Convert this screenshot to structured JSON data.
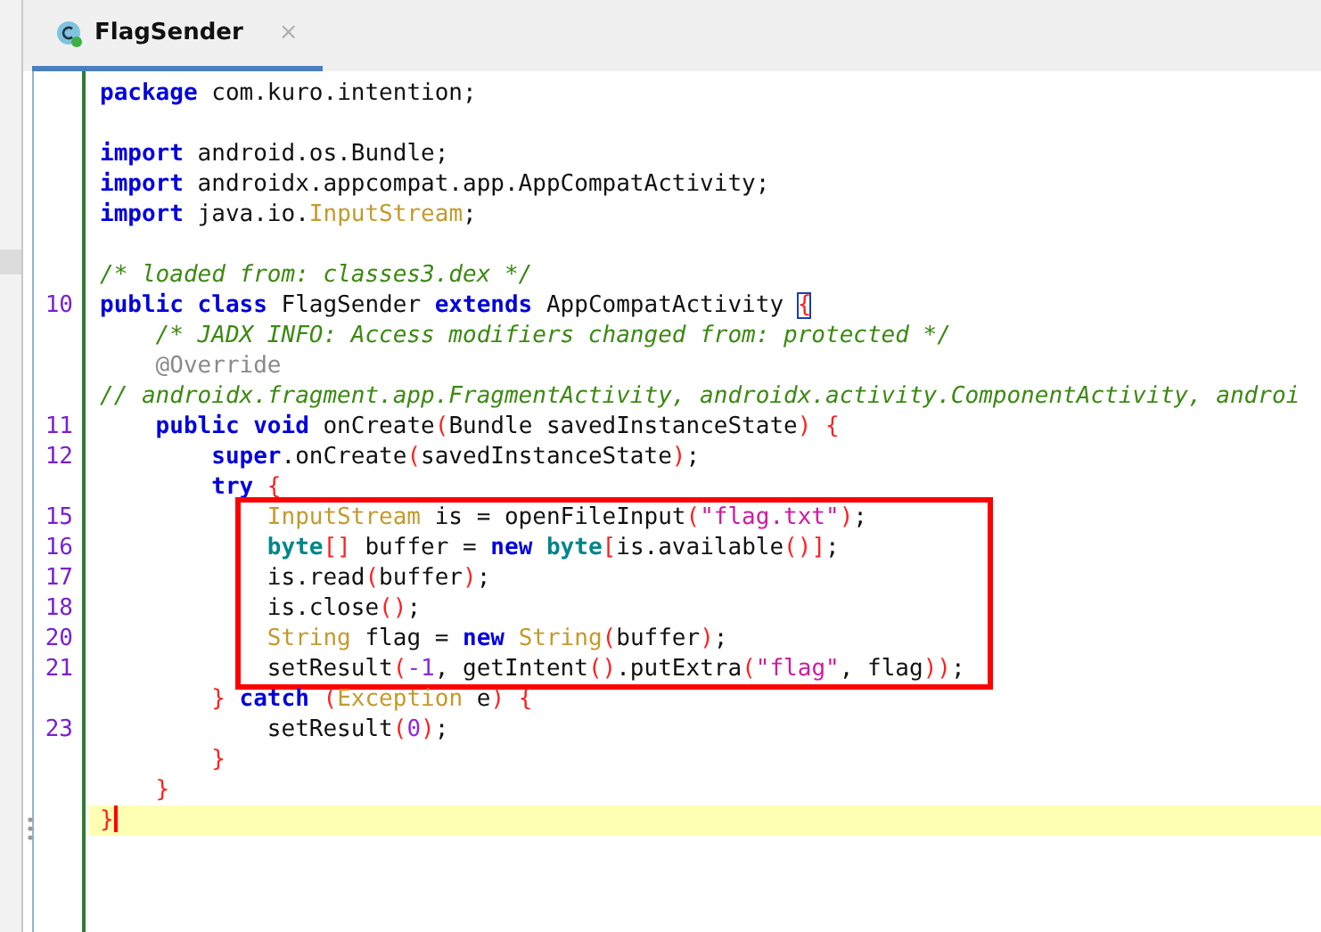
{
  "tab": {
    "title": "FlagSender",
    "close": "×",
    "selected": true
  },
  "blocks": [
    {
      "boxed": false,
      "lines": [
        {
          "current": false,
          "tokens": [
            {
              "kind": "keyword",
              "text": "package"
            },
            {
              "kind": "plain",
              "text": " com.kuro.intention;"
            }
          ]
        },
        {
          "current": false
        },
        {
          "current": false,
          "tokens": [
            {
              "kind": "keyword",
              "text": "import"
            },
            {
              "kind": "plain",
              "text": " android.os.Bundle;"
            }
          ]
        },
        {
          "current": false,
          "tokens": [
            {
              "kind": "keyword",
              "text": "import"
            },
            {
              "kind": "plain",
              "text": " androidx.appcompat.app.AppCompatActivity;"
            }
          ]
        },
        {
          "current": false,
          "tokens": [
            {
              "kind": "keyword",
              "text": "import"
            },
            {
              "kind": "plain",
              "text": " java.io."
            },
            {
              "kind": "type",
              "text": "InputStream"
            },
            {
              "kind": "plain",
              "text": ";"
            }
          ]
        },
        {
          "current": false
        },
        {
          "current": false,
          "tokens": [
            {
              "kind": "comment",
              "text": "/* loaded from: classes3.dex */"
            }
          ]
        },
        {
          "number": "10",
          "current": false,
          "tokens": [
            {
              "kind": "keyword",
              "text": "public class"
            },
            {
              "kind": "plain",
              "text": " FlagSender "
            },
            {
              "kind": "keyword",
              "text": "extends"
            },
            {
              "kind": "plain",
              "text": " AppCompatActivity "
            },
            {
              "kind": "matched",
              "text": "{"
            }
          ]
        },
        {
          "current": false,
          "tokens": [
            {
              "kind": "comment",
              "text": "    /* JADX INFO: Access modifiers changed from: protected */"
            }
          ]
        },
        {
          "current": false,
          "tokens": [
            {
              "kind": "annotation",
              "text": "    @Override"
            }
          ]
        },
        {
          "current": false,
          "tokens": [
            {
              "kind": "comment",
              "text": "// androidx.fragment.app.FragmentActivity, androidx.activity.ComponentActivity, androi"
            }
          ]
        },
        {
          "number": "11",
          "current": false,
          "tokens": [
            {
              "kind": "keyword",
              "text": "    public void"
            },
            {
              "kind": "plain",
              "text": " onCreate"
            },
            {
              "kind": "bracket",
              "text": "("
            },
            {
              "kind": "plain",
              "text": "Bundle savedInstanceState"
            },
            {
              "kind": "bracket",
              "text": ") {"
            }
          ]
        },
        {
          "number": "12",
          "current": false,
          "tokens": [
            {
              "kind": "keyword",
              "text": "        super"
            },
            {
              "kind": "plain",
              "text": ".onCreate"
            },
            {
              "kind": "bracket",
              "text": "("
            },
            {
              "kind": "plain",
              "text": "savedInstanceState"
            },
            {
              "kind": "bracket",
              "text": ")"
            },
            {
              "kind": "plain",
              "text": ";"
            }
          ]
        },
        {
          "current": false,
          "tokens": [
            {
              "kind": "keyword",
              "text": "        try"
            },
            {
              "kind": "bracket",
              "text": " {"
            }
          ]
        }
      ]
    },
    {
      "boxed": true,
      "lines": [
        {
          "number": "15",
          "current": false,
          "tokens": [
            {
              "kind": "type",
              "text": "            InputStream"
            },
            {
              "kind": "plain",
              "text": " is = openFileInput"
            },
            {
              "kind": "bracket",
              "text": "("
            },
            {
              "kind": "string",
              "text": "\"flag.txt\""
            },
            {
              "kind": "bracket",
              "text": ")"
            },
            {
              "kind": "plain",
              "text": ";"
            }
          ]
        },
        {
          "number": "16",
          "current": false,
          "tokens": [
            {
              "kind": "primitive",
              "text": "            byte"
            },
            {
              "kind": "bracket",
              "text": "[]"
            },
            {
              "kind": "plain",
              "text": " buffer = "
            },
            {
              "kind": "keyword",
              "text": "new"
            },
            {
              "kind": "primitive",
              "text": " byte"
            },
            {
              "kind": "bracket",
              "text": "["
            },
            {
              "kind": "plain",
              "text": "is.available"
            },
            {
              "kind": "bracket",
              "text": "()]"
            },
            {
              "kind": "plain",
              "text": ";"
            }
          ]
        },
        {
          "number": "17",
          "current": false,
          "tokens": [
            {
              "kind": "plain",
              "text": "            is.read"
            },
            {
              "kind": "bracket",
              "text": "("
            },
            {
              "kind": "plain",
              "text": "buffer"
            },
            {
              "kind": "bracket",
              "text": ")"
            },
            {
              "kind": "plain",
              "text": ";"
            }
          ]
        },
        {
          "number": "18",
          "current": false,
          "tokens": [
            {
              "kind": "plain",
              "text": "            is.close"
            },
            {
              "kind": "bracket",
              "text": "()"
            },
            {
              "kind": "plain",
              "text": ";"
            }
          ]
        },
        {
          "number": "20",
          "current": false,
          "tokens": [
            {
              "kind": "type",
              "text": "            String"
            },
            {
              "kind": "plain",
              "text": " flag = "
            },
            {
              "kind": "keyword",
              "text": "new"
            },
            {
              "kind": "type",
              "text": " String"
            },
            {
              "kind": "bracket",
              "text": "("
            },
            {
              "kind": "plain",
              "text": "buffer"
            },
            {
              "kind": "bracket",
              "text": ")"
            },
            {
              "kind": "plain",
              "text": ";"
            }
          ]
        },
        {
          "number": "21",
          "current": false,
          "tokens": [
            {
              "kind": "plain",
              "text": "            setResult"
            },
            {
              "kind": "bracket",
              "text": "("
            },
            {
              "kind": "number",
              "text": "-1"
            },
            {
              "kind": "plain",
              "text": ", getIntent"
            },
            {
              "kind": "bracket",
              "text": "()"
            },
            {
              "kind": "plain",
              "text": ".putExtra"
            },
            {
              "kind": "bracket",
              "text": "("
            },
            {
              "kind": "string",
              "text": "\"flag\""
            },
            {
              "kind": "plain",
              "text": ", flag"
            },
            {
              "kind": "bracket",
              "text": "))"
            },
            {
              "kind": "plain",
              "text": ";"
            }
          ]
        }
      ]
    },
    {
      "boxed": false,
      "lines": [
        {
          "current": false,
          "tokens": [
            {
              "kind": "bracket",
              "text": "        }"
            },
            {
              "kind": "keyword",
              "text": " catch"
            },
            {
              "kind": "bracket",
              "text": " ("
            },
            {
              "kind": "type",
              "text": "Exception"
            },
            {
              "kind": "plain",
              "text": " e"
            },
            {
              "kind": "bracket",
              "text": ") {"
            }
          ]
        },
        {
          "number": "23",
          "current": false,
          "tokens": [
            {
              "kind": "plain",
              "text": "            setResult"
            },
            {
              "kind": "bracket",
              "text": "("
            },
            {
              "kind": "number",
              "text": "0"
            },
            {
              "kind": "bracket",
              "text": ")"
            },
            {
              "kind": "plain",
              "text": ";"
            }
          ]
        },
        {
          "current": false,
          "tokens": [
            {
              "kind": "bracket",
              "text": "        }"
            }
          ]
        },
        {
          "current": false,
          "tokens": [
            {
              "kind": "bracket",
              "text": "    }"
            }
          ]
        },
        {
          "current": true,
          "tokens": [
            {
              "kind": "bracket",
              "text": "}"
            }
          ]
        }
      ]
    }
  ]
}
